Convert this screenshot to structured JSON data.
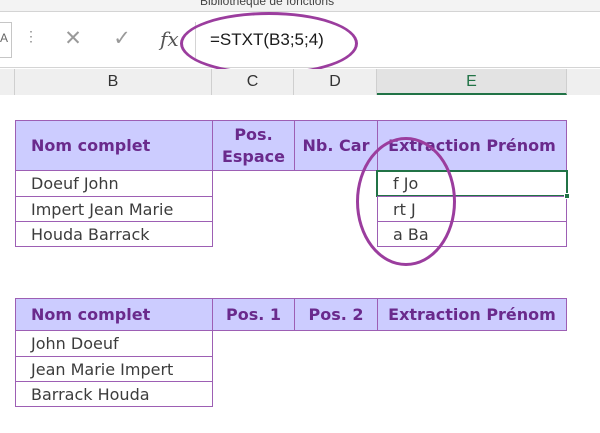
{
  "ribbon": {
    "group_label": "Bibliothèque de fonctions"
  },
  "formula_bar": {
    "namebox_fragment": "A",
    "dots": "⋮",
    "cancel_icon": "✕",
    "enter_icon": "✓",
    "fx_label": "fx",
    "formula": "=STXT(B3;5;4)"
  },
  "columns": [
    "B",
    "C",
    "D",
    "E"
  ],
  "selected_column": "E",
  "table1": {
    "headers": [
      "Nom complet",
      "Pos. Espace",
      "Nb. Car",
      "Extraction Prénom"
    ],
    "names": [
      "Doeuf John",
      "Impert Jean Marie",
      "Houda Barrack"
    ],
    "extractions": [
      "f Jo",
      "rt J",
      "a Ba"
    ]
  },
  "table2": {
    "headers": [
      "Nom complet",
      "Pos. 1",
      "Pos. 2",
      "Extraction Prénom"
    ],
    "names": [
      "John Doeuf",
      "Jean Marie Impert",
      "Barrack Houda"
    ]
  },
  "colors": {
    "header_fill": "#ccccff",
    "header_text": "#6a2a8c",
    "border": "#9d5fb4",
    "annotation": "#9b3d9e",
    "selection": "#217346"
  }
}
